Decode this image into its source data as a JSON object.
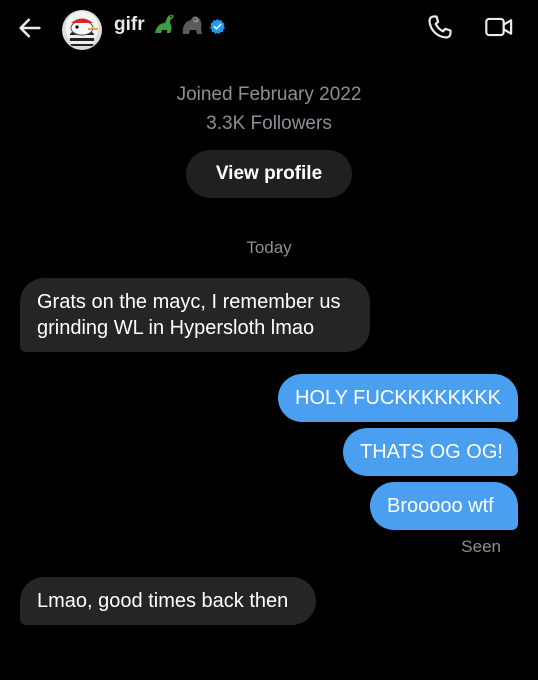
{
  "header": {
    "name": "gifr",
    "icons": [
      "back-arrow-icon",
      "dinosaur-emoji-icon",
      "gorilla-emoji-icon",
      "verified-badge-icon",
      "phone-call-icon",
      "video-call-icon"
    ],
    "accent_color": "#1d9bf0"
  },
  "profile": {
    "joined": "Joined February 2022",
    "followers": "3.3K Followers",
    "view_profile": "View profile"
  },
  "conversation": {
    "date_separator": "Today",
    "messages": [
      {
        "from": "them",
        "text": "Grats on the mayc, I remember us grinding WL in Hypersloth lmao"
      },
      {
        "from": "me",
        "text": "HOLY FUCKKKKKKKK"
      },
      {
        "from": "me",
        "text": "THATS OG OG!"
      },
      {
        "from": "me",
        "text": "Brooooo wtf"
      },
      {
        "from": "them",
        "text": "Lmao, good times back then"
      }
    ],
    "seen_label": "Seen"
  },
  "colors": {
    "background": "#000000",
    "sent_bubble": "#4a9ff0",
    "received_bubble": "#242526",
    "muted_text": "#8b9096"
  }
}
